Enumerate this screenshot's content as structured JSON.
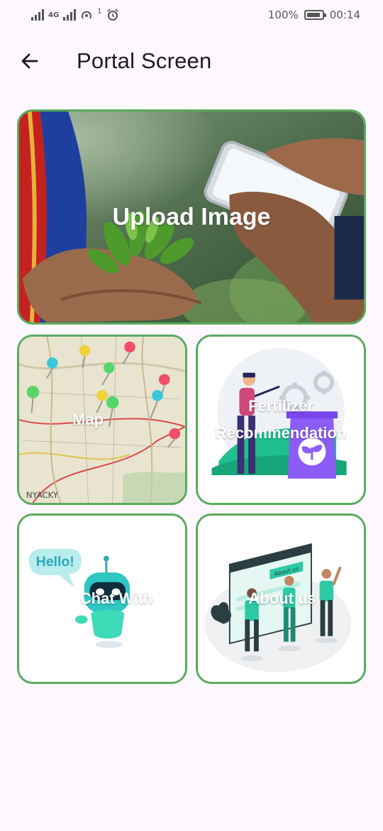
{
  "status_bar": {
    "network_label": "4G",
    "notification_count": "1",
    "battery_percent": "100%",
    "time": "00:14"
  },
  "app_bar": {
    "title": "Portal Screen",
    "back_icon": "arrow-left-icon"
  },
  "cards": {
    "upload": {
      "label": "Upload Image"
    },
    "map": {
      "label": "Map"
    },
    "fertilizer": {
      "label_line1": "Fertilizer",
      "label_line2": "Recommendation"
    },
    "chat": {
      "label": "Chat With",
      "bubble_text": "Hello!"
    },
    "about": {
      "label": "About us",
      "screen_text": "About us"
    }
  },
  "colors": {
    "background": "#fdf7ff",
    "card_border": "#5aab5d",
    "accent_teal": "#2cc9a5",
    "accent_purple": "#8b5cf6"
  }
}
